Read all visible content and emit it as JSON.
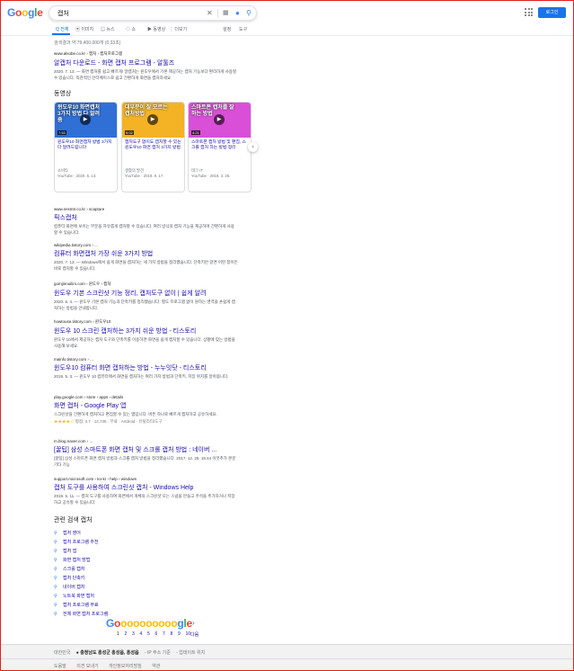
{
  "header": {
    "logo": [
      "G",
      "o",
      "o",
      "g",
      "l",
      "e"
    ],
    "query": "캡처",
    "login_label": "로그인"
  },
  "tabs": [
    {
      "label": "Q 전체",
      "active": true
    },
    {
      "label": "▣ 이미지"
    },
    {
      "label": "▤ 뉴스"
    },
    {
      "label": "◇ 쇼"
    },
    {
      "label": "▶ 동영상"
    },
    {
      "label": "⋮ 더보기"
    },
    {
      "label": "설정"
    },
    {
      "label": "도구"
    }
  ],
  "stats": "검색결과 약 79,400,000개 (0.33초)",
  "results_top": [
    {
      "url": "www.alsobe.co.kr › 캡처 › 캡처프로그램",
      "title": "알캡처 다운로드 - 화면 캡처 프로그램 - 알툴즈",
      "snippet": "2020. 7. 13. — 화면 캡처를 쉽고 빠르게! 알캡처는 윈도우에서 기본 제공하는 캡처 기능보다 편리하게 사용할 수 있습니다. 직관적인 인터페이스로 쉽고 간편하게 화면을 캡처하세요."
    }
  ],
  "videos_title": "동영상",
  "videos": [
    {
      "thumb_text": "윈도우10 화면캡처 3가지 방법 다 알려줌",
      "duration": "7:53",
      "title": "윈도우10 화면캡처 방법 3가지 다 알려드립니다",
      "source": "소비타",
      "date": "YouTube · 2020. 5. 13.",
      "bg": "#2f6fd6"
    },
    {
      "thumb_text": "대부분이 잘 모르는 캡처방법",
      "duration": "5:02",
      "title": "캡처도구 없이도 캡처할 수 있는 윈도우10 화면 캡처 3가지 방법",
      "source": "생활의 발견",
      "date": "YouTube · 2019. 9. 17.",
      "bg": "#f3b325"
    },
    {
      "thumb_text": "스마트폰 캡처를 잘하는 방법",
      "duration": "4:21",
      "title": "스마트폰 캡처 방법 및 편집, 스크롤 캡처 하는 방법 정리",
      "source": "테크 IT",
      "date": "YouTube · 2018. 3. 25.",
      "bg": "#d94fd8"
    }
  ],
  "results": [
    {
      "url": "www.snsmtr.co.kr › scapture",
      "title": "픽스캡처",
      "snippet": "컴퓨터 화면에 보이는 부분을 자유롭게 캡처할 수 있습니다. 여러 방식의 캡처 기능을 제공하며 간편하게 사용할 수 있습니다."
    },
    {
      "url": "wikipedia.tistory.com › ...",
      "title": "컴퓨터 화면캡처 가장 쉬운 3가지 방법",
      "snippet": "2020. 7. 13. — Windows에서 쉽게 화면을 캡처하는 세 가지 방법을 정리했습니다. 단축키만 알면 어떤 창이든 바로 캡처할 수 있습니다."
    },
    {
      "url": "gomjinnuilim.com › 윈도우 › 캡처",
      "title": "윈도우 기본 스크린샷 기능 정리, 캡처도구 없이 | 쉽게 알려",
      "snippet": "2020. 6. 4. — 윈도우 기본 캡처 기능과 단축키를 정리했습니다. 별도 프로그램 없이 원하는 영역을 손쉽게 캡처하는 방법을 안내합니다."
    },
    {
      "url": "howtouse.tistory.com › 윈도우10",
      "title": "윈도우 10 스크린 캡처하는 3가지 쉬운 방법 - 티스토리",
      "snippet": "윈도우 10에서 제공하는 캡처 도구와 단축키를 이용하면 화면을 쉽게 캡처할 수 있습니다. 상황에 맞는 방법을 사용해 보세요."
    },
    {
      "url": "mainfo.tistory.com › ...",
      "title": "윈도우10 컴퓨터 화면 캡처하는 방법 - 누누잇닷 - 티스토리",
      "snippet": "2019. 5. 3. — 윈도우 10 컴퓨터에서 화면을 캡처하는 여러 가지 방법과 단축키, 저장 위치를 알아봅니다."
    },
    {
      "url": "play.google.com › store › apps › details",
      "title": "화면 캡처 - Google Play 앱",
      "snippet": "스크린샷을 간편하게 캡처하고 편집할 수 있는 앱입니다. 버튼 하나로 빠르게 캡처하고 공유하세요.",
      "rating": "★★★★☆",
      "rating_text": "평점: 3.7 · 12,736 · 무료 · Android · 유틸리티/도구"
    },
    {
      "url": "m.blog.naver.com › ...",
      "title": "[꿀팁] 삼성 스마트폰 화면 캡처 및 스크롤 캡처 방법 : 네이버 ...",
      "snippet": "[꿀팁] 삼성 스마트폰 화면 캡처 방법과 스크롤 캡처 방법을 정리했습니다. 2017. 12. 26. 15:44 이웃추가 본문 기타 기능"
    },
    {
      "url": "support.microsoft.com › ko-kr › help › windows",
      "title": "캡처 도구를 사용하여 스크린샷 캡처 - Windows Help",
      "snippet": "2019. 5. 11. — 캡처 도구를 사용하여 화면에서 개체의 스크린샷 또는 스냅을 만들고 주석을 추가하거나 저장하고 공유할 수 있습니다."
    }
  ],
  "related_title": "관련 검색 캡처",
  "related": [
    "캡처 영어",
    "캡처 프로그램 추천",
    "캡처 앱",
    "화면 캡처 방법",
    "스크롤 캡처",
    "캡처 단축키",
    "네이버 캡처",
    "노트북 화면 캡처",
    "캡처 프로그램 무료",
    "전체 화면 캡처 프로그램"
  ],
  "pagination": {
    "logo": [
      "G",
      "o",
      "o",
      "o",
      "o",
      "o",
      "o",
      "o",
      "o",
      "o",
      "o",
      "g",
      "l",
      "e"
    ],
    "pages": [
      "1",
      "2",
      "3",
      "4",
      "5",
      "6",
      "7",
      "8",
      "9",
      "10"
    ],
    "next": "다음"
  },
  "footer": {
    "country": "대한민국",
    "location": "● 충청남도 홍성군 홍성읍, 홍성읍",
    "location_note": "- IP 주소 기준",
    "update": "- 업데이트 위치",
    "help": "도움말",
    "links": [
      "도움말",
      "의견 보내기",
      "개인정보처리방침",
      "약관"
    ]
  },
  "colors": {
    "accent": "#1a73e8",
    "link": "#1a0dab",
    "frame": "#e0201e"
  }
}
